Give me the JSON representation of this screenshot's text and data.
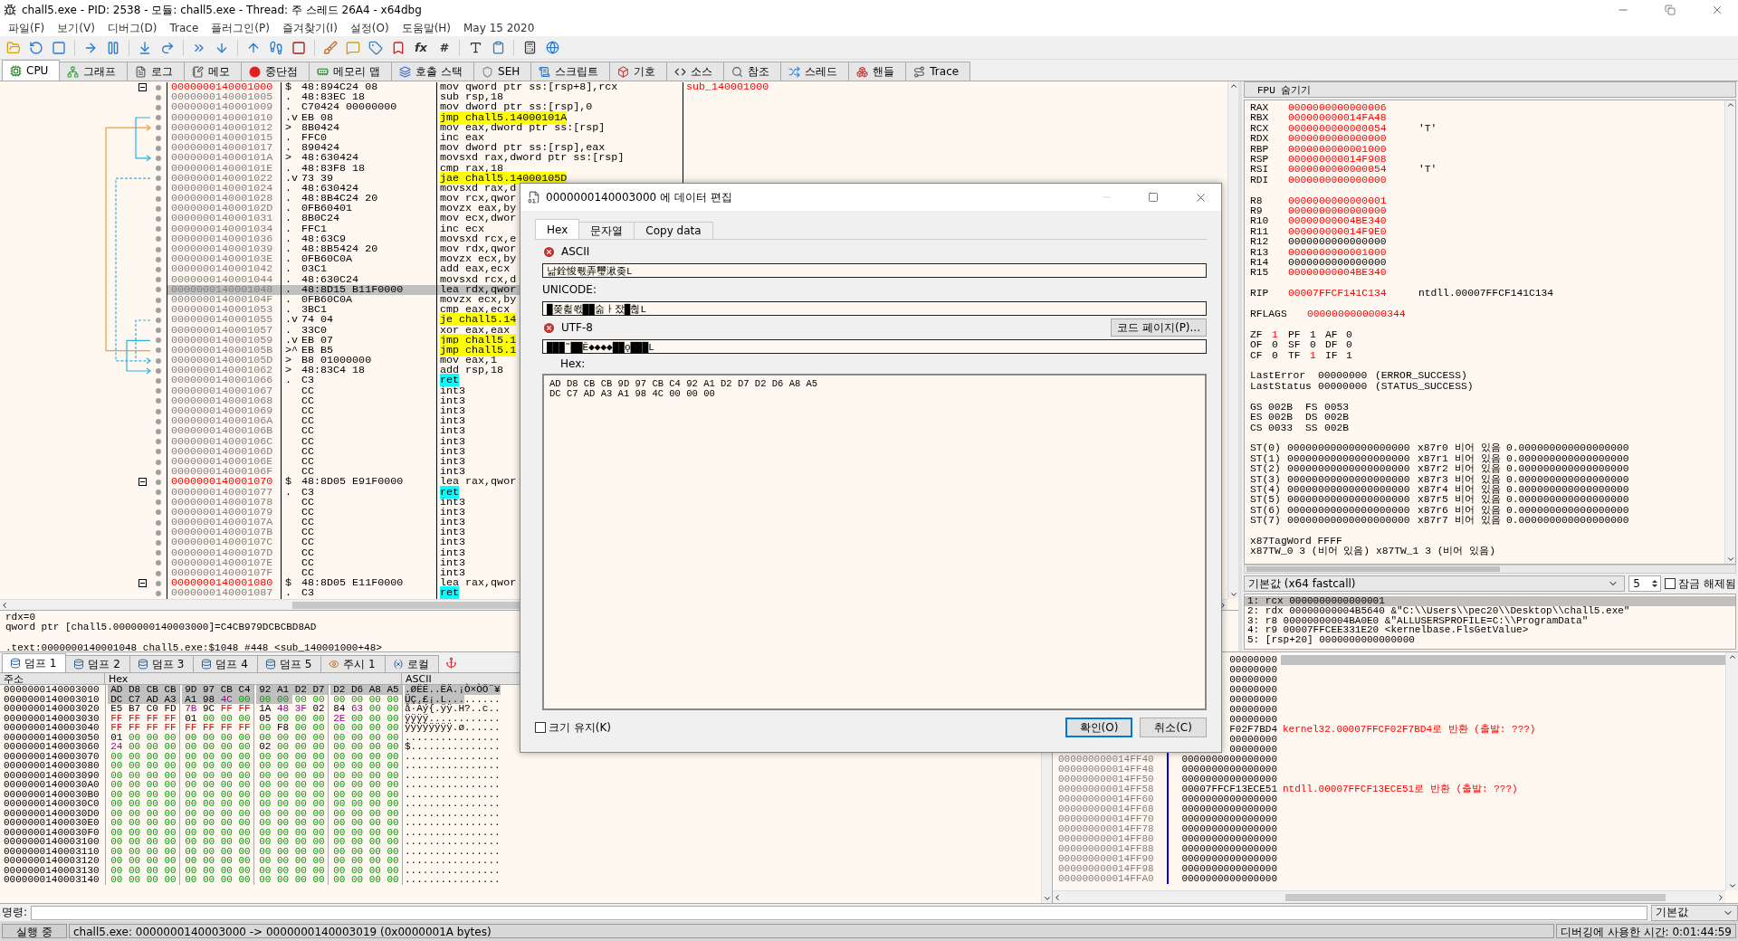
{
  "window": {
    "title": "chall5.exe - PID: 2538 - 모듈: chall5.exe - Thread: 주 스레드 26A4 - x64dbg"
  },
  "menu": [
    "파일(F)",
    "보기(V)",
    "디버그(D)",
    "Trace",
    "플러그인(P)",
    "즐겨찾기(I)",
    "설정(O)",
    "도움말(H)"
  ],
  "build_date": "May 15 2020",
  "toolbar": {
    "glyph_buttons": [
      "fx",
      "#"
    ]
  },
  "tabs": [
    {
      "label": "CPU",
      "selected": true
    },
    {
      "label": "그래프",
      "selected": false
    },
    {
      "label": "로그",
      "selected": false
    },
    {
      "label": "메모",
      "selected": false
    },
    {
      "label": "중단점",
      "selected": false
    },
    {
      "label": "메모리 맵",
      "selected": false
    },
    {
      "label": "호출 스택",
      "selected": false
    },
    {
      "label": "SEH",
      "selected": false
    },
    {
      "label": "스크립트",
      "selected": false
    },
    {
      "label": "기호",
      "selected": false
    },
    {
      "label": "소스",
      "selected": false
    },
    {
      "label": "참조",
      "selected": false
    },
    {
      "label": "스레드",
      "selected": false
    },
    {
      "label": "핸들",
      "selected": false
    },
    {
      "label": "Trace",
      "selected": false
    }
  ],
  "disasm": {
    "rows": [
      {
        "address": "0000000140001000",
        "marker": "$",
        "bytes": "48:894C24 08",
        "instruction": "mov qword ptr ss:[rsp+8],rcx",
        "entry": true,
        "kind": "plain",
        "selected": false,
        "comment": "sub_140001000"
      },
      {
        "address": "0000000140001005",
        "marker": ".",
        "bytes": "48:83EC 18",
        "instruction": "sub rsp,18",
        "entry": false,
        "kind": "plain",
        "selected": false
      },
      {
        "address": "0000000140001009",
        "marker": ".",
        "bytes": "C70424 00000000",
        "instruction": "mov dword ptr ss:[rsp],0",
        "entry": false,
        "kind": "plain",
        "selected": false
      },
      {
        "address": "0000000140001010",
        "marker": ".v",
        "bytes": "EB 08",
        "instruction": "jmp chall5.14000101A",
        "entry": false,
        "kind": "jump",
        "selected": false
      },
      {
        "address": "0000000140001012",
        "marker": ">",
        "bytes": "8B0424",
        "instruction": "mov eax,dword ptr ss:[rsp]",
        "entry": false,
        "kind": "plain",
        "selected": false
      },
      {
        "address": "0000000140001015",
        "marker": ".",
        "bytes": "FFC0",
        "instruction": "inc eax",
        "entry": false,
        "kind": "plain",
        "selected": false
      },
      {
        "address": "0000000140001017",
        "marker": ".",
        "bytes": "890424",
        "instruction": "mov dword ptr ss:[rsp],eax",
        "entry": false,
        "kind": "plain",
        "selected": false
      },
      {
        "address": "000000014000101A",
        "marker": ">",
        "bytes": "48:630424",
        "instruction": "movsxd rax,dword ptr ss:[rsp]",
        "entry": false,
        "kind": "plain",
        "selected": false
      },
      {
        "address": "000000014000101E",
        "marker": ".",
        "bytes": "48:83F8 18",
        "instruction": "cmp rax,18",
        "entry": false,
        "kind": "plain",
        "selected": false
      },
      {
        "address": "0000000140001022",
        "marker": ".v",
        "bytes": "73 39",
        "instruction": "jae chall5.14000105D",
        "entry": false,
        "kind": "jump",
        "selected": false
      },
      {
        "address": "0000000140001024",
        "marker": ".",
        "bytes": "48:630424",
        "instruction": "movsxd rax,d",
        "entry": false,
        "kind": "plain",
        "selected": false
      },
      {
        "address": "0000000140001028",
        "marker": ".",
        "bytes": "48:8B4C24 20",
        "instruction": "mov rcx,qwor",
        "entry": false,
        "kind": "plain",
        "selected": false
      },
      {
        "address": "000000014000102D",
        "marker": ".",
        "bytes": "0FB60401",
        "instruction": "movzx eax,by",
        "entry": false,
        "kind": "plain",
        "selected": false
      },
      {
        "address": "0000000140001031",
        "marker": ".",
        "bytes": "8B0C24",
        "instruction": "mov ecx,dwor",
        "entry": false,
        "kind": "plain",
        "selected": false
      },
      {
        "address": "0000000140001034",
        "marker": ".",
        "bytes": "FFC1",
        "instruction": "inc ecx",
        "entry": false,
        "kind": "plain",
        "selected": false
      },
      {
        "address": "0000000140001036",
        "marker": ".",
        "bytes": "48:63C9",
        "instruction": "movsxd rcx,e",
        "entry": false,
        "kind": "plain",
        "selected": false
      },
      {
        "address": "0000000140001039",
        "marker": ".",
        "bytes": "48:8B5424 20",
        "instruction": "mov rdx,qwor",
        "entry": false,
        "kind": "plain",
        "selected": false
      },
      {
        "address": "000000014000103E",
        "marker": ".",
        "bytes": "0FB60C0A",
        "instruction": "movzx ecx,by",
        "entry": false,
        "kind": "plain",
        "selected": false
      },
      {
        "address": "0000000140001042",
        "marker": ".",
        "bytes": "03C1",
        "instruction": "add eax,ecx",
        "entry": false,
        "kind": "plain",
        "selected": false
      },
      {
        "address": "0000000140001044",
        "marker": ".",
        "bytes": "48:630C24",
        "instruction": "movsxd rcx,d",
        "entry": false,
        "kind": "plain",
        "selected": false
      },
      {
        "address": "0000000140001048",
        "marker": ".",
        "bytes": "48:8D15 B11F0000",
        "instruction": "lea rdx,qwor",
        "entry": false,
        "kind": "plain",
        "selected": true
      },
      {
        "address": "000000014000104F",
        "marker": ".",
        "bytes": "0FB60C0A",
        "instruction": "movzx ecx,by",
        "entry": false,
        "kind": "plain",
        "selected": false
      },
      {
        "address": "0000000140001053",
        "marker": ".",
        "bytes": "3BC1",
        "instruction": "cmp eax,ecx",
        "entry": false,
        "kind": "plain",
        "selected": false
      },
      {
        "address": "0000000140001055",
        "marker": ".v",
        "bytes": "74 04",
        "instruction": "je chall5.14",
        "entry": false,
        "kind": "jump",
        "selected": false
      },
      {
        "address": "0000000140001057",
        "marker": ".",
        "bytes": "33C0",
        "instruction": "xor eax,eax",
        "entry": false,
        "kind": "plain",
        "selected": false
      },
      {
        "address": "0000000140001059",
        "marker": ".v",
        "bytes": "EB 07",
        "instruction": "jmp chall5.1",
        "entry": false,
        "kind": "jump",
        "selected": false
      },
      {
        "address": "000000014000105B",
        "marker": ">^",
        "bytes": "EB B5",
        "instruction": "jmp chall5.1",
        "entry": false,
        "kind": "jump",
        "selected": false
      },
      {
        "address": "000000014000105D",
        "marker": ">",
        "bytes": "B8 01000000",
        "instruction": "mov eax,1",
        "entry": false,
        "kind": "plain",
        "selected": false
      },
      {
        "address": "0000000140001062",
        "marker": ">",
        "bytes": "48:83C4 18",
        "instruction": "add rsp,18",
        "entry": false,
        "kind": "plain",
        "selected": false
      },
      {
        "address": "0000000140001066",
        "marker": ".",
        "bytes": "C3",
        "instruction": "ret",
        "entry": false,
        "kind": "ret",
        "selected": false
      },
      {
        "address": "0000000140001067",
        "bytes": "CC",
        "instruction": "int3",
        "entry": false,
        "kind": "plain",
        "selected": false
      },
      {
        "address": "0000000140001068",
        "bytes": "CC",
        "instruction": "int3",
        "entry": false,
        "kind": "plain",
        "selected": false
      },
      {
        "address": "0000000140001069",
        "bytes": "CC",
        "instruction": "int3",
        "entry": false,
        "kind": "plain",
        "selected": false
      },
      {
        "address": "000000014000106A",
        "bytes": "CC",
        "instruction": "int3",
        "entry": false,
        "kind": "plain",
        "selected": false
      },
      {
        "address": "000000014000106B",
        "bytes": "CC",
        "instruction": "int3",
        "entry": false,
        "kind": "plain",
        "selected": false
      },
      {
        "address": "000000014000106C",
        "bytes": "CC",
        "instruction": "int3",
        "entry": false,
        "kind": "plain",
        "selected": false
      },
      {
        "address": "000000014000106D",
        "bytes": "CC",
        "instruction": "int3",
        "entry": false,
        "kind": "plain",
        "selected": false
      },
      {
        "address": "000000014000106E",
        "bytes": "CC",
        "instruction": "int3",
        "entry": false,
        "kind": "plain",
        "selected": false
      },
      {
        "address": "000000014000106F",
        "bytes": "CC",
        "instruction": "int3",
        "entry": false,
        "kind": "plain",
        "selected": false
      },
      {
        "address": "0000000140001070",
        "marker": "$",
        "bytes": "48:8D05 E91F0000",
        "instruction": "lea rax,qwor",
        "entry": true,
        "kind": "plain",
        "selected": false
      },
      {
        "address": "0000000140001077",
        "marker": ".",
        "bytes": "C3",
        "instruction": "ret",
        "entry": false,
        "kind": "ret",
        "selected": false
      },
      {
        "address": "0000000140001078",
        "bytes": "CC",
        "instruction": "int3",
        "entry": false,
        "kind": "plain",
        "selected": false
      },
      {
        "address": "0000000140001079",
        "bytes": "CC",
        "instruction": "int3",
        "entry": false,
        "kind": "plain",
        "selected": false
      },
      {
        "address": "000000014000107A",
        "bytes": "CC",
        "instruction": "int3",
        "entry": false,
        "kind": "plain",
        "selected": false
      },
      {
        "address": "000000014000107B",
        "bytes": "CC",
        "instruction": "int3",
        "entry": false,
        "kind": "plain",
        "selected": false
      },
      {
        "address": "000000014000107C",
        "bytes": "CC",
        "instruction": "int3",
        "entry": false,
        "kind": "plain",
        "selected": false
      },
      {
        "address": "000000014000107D",
        "bytes": "CC",
        "instruction": "int3",
        "entry": false,
        "kind": "plain",
        "selected": false
      },
      {
        "address": "000000014000107E",
        "bytes": "CC",
        "instruction": "int3",
        "entry": false,
        "kind": "plain",
        "selected": false
      },
      {
        "address": "000000014000107F",
        "bytes": "CC",
        "instruction": "int3",
        "entry": false,
        "kind": "plain",
        "selected": false
      },
      {
        "address": "0000000140001080",
        "marker": "$",
        "bytes": "48:8D05 E11F0000",
        "instruction": "lea rax,qwor",
        "entry": true,
        "kind": "plain",
        "selected": false
      },
      {
        "address": "0000000140001087",
        "marker": ".",
        "bytes": "C3",
        "instruction": "ret",
        "entry": false,
        "kind": "ret",
        "selected": false
      }
    ]
  },
  "info": {
    "lines": [
      "rdx=0",
      "qword ptr [chall5.0000000140003000]=C4CB979DCBCBD8AD"
    ],
    "location": ".text:0000000140001048 chall5.exe:$1048 #448 <sub_140001000+48>"
  },
  "registers": {
    "toggle": "FPU 숨기기",
    "groups": [
      {
        "kind": "regs",
        "rows": [
          {
            "cells": [
              {
                "text": "RAX",
                "changed": false
              },
              {
                "text": "0000000000000006",
                "changed": true
              }
            ]
          },
          {
            "cells": [
              {
                "text": "RBX",
                "changed": false
              },
              {
                "text": "000000000014FA48",
                "changed": true
              }
            ]
          },
          {
            "cells": [
              {
                "text": "RCX",
                "changed": false
              },
              {
                "text": "0000000000000054",
                "changed": true
              },
              {
                "text": "'T'",
                "changed": false
              }
            ]
          },
          {
            "cells": [
              {
                "text": "RDX",
                "changed": false
              },
              {
                "text": "0000000000000000",
                "changed": true
              }
            ]
          },
          {
            "cells": [
              {
                "text": "RBP",
                "changed": false
              },
              {
                "text": "0000000000001000",
                "changed": true
              }
            ]
          },
          {
            "cells": [
              {
                "text": "RSP",
                "changed": false
              },
              {
                "text": "000000000014F908",
                "changed": true
              }
            ]
          },
          {
            "cells": [
              {
                "text": "RSI",
                "changed": false
              },
              {
                "text": "0000000000000054",
                "changed": true
              },
              {
                "text": "'T'",
                "changed": false
              }
            ]
          },
          {
            "cells": [
              {
                "text": "RDI",
                "changed": false
              },
              {
                "text": "0000000000000000",
                "changed": true
              }
            ]
          }
        ]
      },
      {
        "kind": "regs",
        "rows": [
          {
            "cells": [
              {
                "text": "R8",
                "changed": false
              },
              {
                "text": "0000000000000001",
                "changed": true
              }
            ]
          },
          {
            "cells": [
              {
                "text": "R9",
                "changed": false
              },
              {
                "text": "0000000000000000",
                "changed": true
              }
            ]
          },
          {
            "cells": [
              {
                "text": "R10",
                "changed": false
              },
              {
                "text": "00000000004BE340",
                "changed": true
              }
            ]
          },
          {
            "cells": [
              {
                "text": "R11",
                "changed": false
              },
              {
                "text": "000000000014F9E0",
                "changed": true
              }
            ]
          },
          {
            "cells": [
              {
                "text": "R12",
                "changed": false
              },
              {
                "text": "0000000000000000",
                "changed": false
              }
            ]
          },
          {
            "cells": [
              {
                "text": "R13",
                "changed": false
              },
              {
                "text": "0000000000001000",
                "changed": true
              }
            ]
          },
          {
            "cells": [
              {
                "text": "R14",
                "changed": false
              },
              {
                "text": "0000000000000000",
                "changed": false
              }
            ]
          },
          {
            "cells": [
              {
                "text": "R15",
                "changed": false
              },
              {
                "text": "00000000004BE340",
                "changed": true
              }
            ]
          }
        ]
      },
      {
        "kind": "regs",
        "rows": [
          {
            "cells": [
              {
                "text": "RIP",
                "changed": false
              },
              {
                "text": "00007FFCF141C134",
                "changed": true
              },
              {
                "text": "ntdll.00007FFCF141C134",
                "changed": false
              }
            ]
          }
        ]
      },
      {
        "kind": "rflags",
        "rows": [
          {
            "cells": [
              {
                "text": "RFLAGS",
                "changed": false
              },
              {
                "text": "0000000000000344",
                "changed": true
              }
            ]
          }
        ]
      },
      {
        "kind": "flags",
        "rows": [
          {
            "cells": [
              {
                "text": "ZF",
                "changed": false
              },
              {
                "text": "1",
                "changed": true
              },
              {
                "text": "PF",
                "changed": false
              },
              {
                "text": "1",
                "changed": false
              },
              {
                "text": "AF",
                "changed": false
              },
              {
                "text": "0",
                "changed": false
              }
            ]
          },
          {
            "cells": [
              {
                "text": "OF",
                "changed": false
              },
              {
                "text": "0",
                "changed": false
              },
              {
                "text": "SF",
                "changed": false
              },
              {
                "text": "0",
                "changed": false
              },
              {
                "text": "DF",
                "changed": false
              },
              {
                "text": "0",
                "changed": false
              }
            ]
          },
          {
            "cells": [
              {
                "text": "CF",
                "changed": false
              },
              {
                "text": "0",
                "changed": false
              },
              {
                "text": "TF",
                "changed": false
              },
              {
                "text": "1",
                "changed": true
              },
              {
                "text": "IF",
                "changed": false
              },
              {
                "text": "1",
                "changed": false
              }
            ]
          }
        ]
      },
      {
        "kind": "error",
        "rows": [
          {
            "cells": [
              {
                "text": "LastError",
                "changed": false
              },
              {
                "text": "00000000",
                "changed": false
              },
              {
                "text": "(ERROR_SUCCESS)",
                "changed": false
              }
            ]
          },
          {
            "cells": [
              {
                "text": "LastStatus",
                "changed": false
              },
              {
                "text": "00000000",
                "changed": false
              },
              {
                "text": "(STATUS_SUCCESS)",
                "changed": false
              }
            ]
          }
        ]
      },
      {
        "kind": "seg",
        "rows": [
          {
            "cells": [
              {
                "text": "GS",
                "changed": false
              },
              {
                "text": "002B",
                "changed": false
              },
              {
                "text": "FS",
                "changed": false
              },
              {
                "text": "0053",
                "changed": false
              }
            ]
          },
          {
            "cells": [
              {
                "text": "ES",
                "changed": false
              },
              {
                "text": "002B",
                "changed": false
              },
              {
                "text": "DS",
                "changed": false
              },
              {
                "text": "002B",
                "changed": false
              }
            ]
          },
          {
            "cells": [
              {
                "text": "CS",
                "changed": false
              },
              {
                "text": "0033",
                "changed": false
              },
              {
                "text": "SS",
                "changed": false
              },
              {
                "text": "002B",
                "changed": false
              }
            ]
          }
        ]
      },
      {
        "kind": "fpu",
        "rows": [
          {
            "cells": [
              {
                "text": "ST(0)",
                "changed": false
              },
              {
                "text": "00000000000000000000",
                "changed": false
              },
              {
                "text": "x87r0",
                "changed": false
              },
              {
                "text": "비어 있음",
                "changed": false
              },
              {
                "text": "0.000000000000000000",
                "changed": false
              }
            ]
          },
          {
            "cells": [
              {
                "text": "ST(1)",
                "changed": false
              },
              {
                "text": "00000000000000000000",
                "changed": false
              },
              {
                "text": "x87r1",
                "changed": false
              },
              {
                "text": "비어 있음",
                "changed": false
              },
              {
                "text": "0.000000000000000000",
                "changed": false
              }
            ]
          },
          {
            "cells": [
              {
                "text": "ST(2)",
                "changed": false
              },
              {
                "text": "00000000000000000000",
                "changed": false
              },
              {
                "text": "x87r2",
                "changed": false
              },
              {
                "text": "비어 있음",
                "changed": false
              },
              {
                "text": "0.000000000000000000",
                "changed": false
              }
            ]
          },
          {
            "cells": [
              {
                "text": "ST(3)",
                "changed": false
              },
              {
                "text": "00000000000000000000",
                "changed": false
              },
              {
                "text": "x87r3",
                "changed": false
              },
              {
                "text": "비어 있음",
                "changed": false
              },
              {
                "text": "0.000000000000000000",
                "changed": false
              }
            ]
          },
          {
            "cells": [
              {
                "text": "ST(4)",
                "changed": false
              },
              {
                "text": "00000000000000000000",
                "changed": false
              },
              {
                "text": "x87r4",
                "changed": false
              },
              {
                "text": "비어 있음",
                "changed": false
              },
              {
                "text": "0.000000000000000000",
                "changed": false
              }
            ]
          },
          {
            "cells": [
              {
                "text": "ST(5)",
                "changed": false
              },
              {
                "text": "00000000000000000000",
                "changed": false
              },
              {
                "text": "x87r5",
                "changed": false
              },
              {
                "text": "비어 있음",
                "changed": false
              },
              {
                "text": "0.000000000000000000",
                "changed": false
              }
            ]
          },
          {
            "cells": [
              {
                "text": "ST(6)",
                "changed": false
              },
              {
                "text": "00000000000000000000",
                "changed": false
              },
              {
                "text": "x87r6",
                "changed": false
              },
              {
                "text": "비어 있음",
                "changed": false
              },
              {
                "text": "0.000000000000000000",
                "changed": false
              }
            ]
          },
          {
            "cells": [
              {
                "text": "ST(7)",
                "changed": false
              },
              {
                "text": "00000000000000000000",
                "changed": false
              },
              {
                "text": "x87r7",
                "changed": false
              },
              {
                "text": "비어 있음",
                "changed": false
              },
              {
                "text": "0.000000000000000000",
                "changed": false
              }
            ]
          }
        ]
      },
      {
        "kind": "text",
        "rows": [
          {
            "cells": [
              {
                "text": "x87TagWord FFFF",
                "changed": false
              }
            ]
          },
          {
            "cells": [
              {
                "text": "x87TW_0 3 (비어 있음) x87TW_1 3 (비어 있음)",
                "changed": false
              }
            ]
          }
        ]
      }
    ]
  },
  "call_convention": {
    "value": "기본값 (x64 fastcall)",
    "count": "5",
    "unlock": {
      "label": "잠금 해제됨",
      "checked": false
    }
  },
  "arguments": [
    {
      "text": "1: rcx 0000000000000001",
      "selected": true
    },
    {
      "text": "2: rdx 00000000004B5640 &\"C:\\\\Users\\\\pec20\\\\Desktop\\\\chall5.exe\"",
      "selected": false
    },
    {
      "text": "3: r8 00000000004BA0E0 &\"ALLUSERSPROFILE=C:\\\\ProgramData\"",
      "selected": false
    },
    {
      "text": "4: r9 00007FFCEE331E20 <kernelbase.FlsGetValue>",
      "selected": false
    },
    {
      "text": "5: [rsp+20] 0000000000000000",
      "selected": false
    }
  ],
  "dump": {
    "tabs": [
      {
        "label": "덤프 1",
        "selected": true
      },
      {
        "label": "덤프 2",
        "selected": false
      },
      {
        "label": "덤프 3",
        "selected": false
      },
      {
        "label": "덤프 4",
        "selected": false
      },
      {
        "label": "덤프 5",
        "selected": false
      },
      {
        "label": "주시 1",
        "selected": false
      },
      {
        "label": "로컬",
        "selected": false
      }
    ],
    "columns": [
      "주소",
      "Hex",
      "ASCII"
    ],
    "rows": [
      {
        "address": "0000000140003000",
        "hex_selected": "AD D8 CB CB 9D 97 CB C4 92 A1 D2 D7 D2 D6 A8 A5",
        "ascii_selected": ".ØËË..ËÄ.¡Ò×ÒÖ¨¥"
      },
      {
        "address": "0000000140003010",
        "hex_selected": "DC C7 AD A3 A1 98 4C 00 00 00",
        "hex": "00 00 00 00 00 00",
        "ascii_selected": "ÜÇ.£¡.L...",
        "ascii": "......"
      },
      {
        "address": "0000000140003020",
        "hex": "E5 B7 C0 FD 7B 9C FF FF 1A 48 3F 02 84 63 00 00",
        "ascii": "å·Àý{.ÿÿ.H?..c.."
      },
      {
        "address": "0000000140003030",
        "hex": "FF FF FF FF 01 00 00 00 05 00 00 00 2E 00 00 00",
        "ascii": "ÿÿÿÿ............"
      },
      {
        "address": "0000000140003040",
        "hex": "FF FF FF FF FF FF FF FF 00 F8 00 00 00 00 00 00",
        "ascii": "ÿÿÿÿÿÿÿÿ.ø......"
      },
      {
        "address": "0000000140003050",
        "hex": "01 00 00 00 00 00 00 00 00 00 00 00 00 00 00 00",
        "ascii": "................"
      },
      {
        "address": "0000000140003060",
        "hex": "24 00 00 00 00 00 00 00 02 00 00 00 00 00 00 00",
        "ascii": "$..............."
      },
      {
        "address": "0000000140003070",
        "hex": "00 00 00 00 00 00 00 00 00 00 00 00 00 00 00 00",
        "ascii": "................"
      },
      {
        "address": "0000000140003080",
        "hex": "00 00 00 00 00 00 00 00 00 00 00 00 00 00 00 00",
        "ascii": "................"
      },
      {
        "address": "0000000140003090",
        "hex": "00 00 00 00 00 00 00 00 00 00 00 00 00 00 00 00",
        "ascii": "................"
      },
      {
        "address": "00000001400030A0",
        "hex": "00 00 00 00 00 00 00 00 00 00 00 00 00 00 00 00",
        "ascii": "................"
      },
      {
        "address": "00000001400030B0",
        "hex": "00 00 00 00 00 00 00 00 00 00 00 00 00 00 00 00",
        "ascii": "................"
      },
      {
        "address": "00000001400030C0",
        "hex": "00 00 00 00 00 00 00 00 00 00 00 00 00 00 00 00",
        "ascii": "................"
      },
      {
        "address": "00000001400030D0",
        "hex": "00 00 00 00 00 00 00 00 00 00 00 00 00 00 00 00",
        "ascii": "................"
      },
      {
        "address": "00000001400030E0",
        "hex": "00 00 00 00 00 00 00 00 00 00 00 00 00 00 00 00",
        "ascii": "................"
      },
      {
        "address": "00000001400030F0",
        "hex": "00 00 00 00 00 00 00 00 00 00 00 00 00 00 00 00",
        "ascii": "................"
      },
      {
        "address": "0000000140003100",
        "hex": "00 00 00 00 00 00 00 00 00 00 00 00 00 00 00 00",
        "ascii": "................"
      },
      {
        "address": "0000000140003110",
        "hex": "00 00 00 00 00 00 00 00 00 00 00 00 00 00 00 00",
        "ascii": "................"
      },
      {
        "address": "0000000140003120",
        "hex": "00 00 00 00 00 00 00 00 00 00 00 00 00 00 00 00",
        "ascii": "................"
      },
      {
        "address": "0000000140003130",
        "hex": "00 00 00 00 00 00 00 00 00 00 00 00 00 00 00 00",
        "ascii": "................"
      },
      {
        "address": "0000000140003140",
        "hex": "00 00 00 00 00 00 00 00 00 00 00 00 00 00 00 00",
        "ascii": "................"
      }
    ]
  },
  "stack": {
    "rows": [
      {
        "value": "00000000",
        "selected": true
      },
      {
        "value": "00000000",
        "selected": false
      },
      {
        "value": "00000000",
        "selected": false
      },
      {
        "value": "00000000",
        "selected": false
      },
      {
        "value": "00000000",
        "selected": false
      },
      {
        "value": "00000000",
        "selected": false
      },
      {
        "value": "00000000",
        "selected": false
      },
      {
        "value": "F02F7BD4",
        "comment": "kernel32.00007FFCF02F7BD4로 반환 (출발: ???)",
        "selected": false
      },
      {
        "value": "00000000",
        "selected": false
      },
      {
        "value": "00000000",
        "selected": false
      },
      {
        "address": "000000000014FF40",
        "value": "0000000000000000",
        "selected": false
      },
      {
        "address": "000000000014FF48",
        "value": "0000000000000000",
        "selected": false
      },
      {
        "address": "000000000014FF50",
        "value": "0000000000000000",
        "selected": false
      },
      {
        "address": "000000000014FF58",
        "value": "00007FFCF13ECE51",
        "comment": "ntdll.00007FFCF13ECE51로 반환 (출발: ???)",
        "selected": false
      },
      {
        "address": "000000000014FF60",
        "value": "0000000000000000",
        "selected": false
      },
      {
        "address": "000000000014FF68",
        "value": "0000000000000000",
        "selected": false
      },
      {
        "address": "000000000014FF70",
        "value": "0000000000000000",
        "selected": false
      },
      {
        "address": "000000000014FF78",
        "value": "0000000000000000",
        "selected": false
      },
      {
        "address": "000000000014FF80",
        "value": "0000000000000000",
        "selected": false
      },
      {
        "address": "000000000014FF88",
        "value": "0000000000000000",
        "selected": false
      },
      {
        "address": "000000000014FF90",
        "value": "0000000000000000",
        "selected": false
      },
      {
        "address": "000000000014FF98",
        "value": "0000000000000000",
        "selected": false
      },
      {
        "address": "000000000014FFA0",
        "value": "0000000000000000",
        "selected": false
      }
    ]
  },
  "command": {
    "label": "명령:",
    "mode": "기본값"
  },
  "status_bar": {
    "state": "실행 중",
    "message": "chall5.exe: 0000000140003000 -> 0000000140003019 (0x0000001A bytes)",
    "timer": "디버깅에 사용한 시간: 0:01:44:59"
  },
  "dialog": {
    "title": "0000000140003000 에 데이터 편집",
    "tabs": [
      {
        "label": "Hex",
        "selected": true
      },
      {
        "label": "문자열",
        "selected": false
      },
      {
        "label": "Copy data",
        "selected": false
      }
    ],
    "ascii": {
      "label": "ASCII",
      "valid": false,
      "value": "낢銓悛뤣弄璽湫좆L"
    },
    "unicode": {
      "label": "UNICODE:",
      "value": "█쫒쵧쐯██숢ㅏ잤█췮L"
    },
    "utf8": {
      "label": "UTF-8",
      "valid": false,
      "value": "███˜██Ē◆◆◆◆██ǫ███L"
    },
    "code_page_button": "코드 페이지(P)...",
    "hex_label": "Hex:",
    "hex_lines": [
      "AD D8 CB CB 9D 97 CB C4 92 A1 D2 D7 D2 D6 A8 A5",
      "DC C7 AD A3 A1 98 4C 00 00 00"
    ],
    "keep_size": {
      "label": "크기 유지(K)",
      "checked": false
    },
    "buttons": [
      {
        "label": "확인(O)",
        "default": true
      },
      {
        "label": "취소(C)",
        "default": false
      }
    ]
  }
}
